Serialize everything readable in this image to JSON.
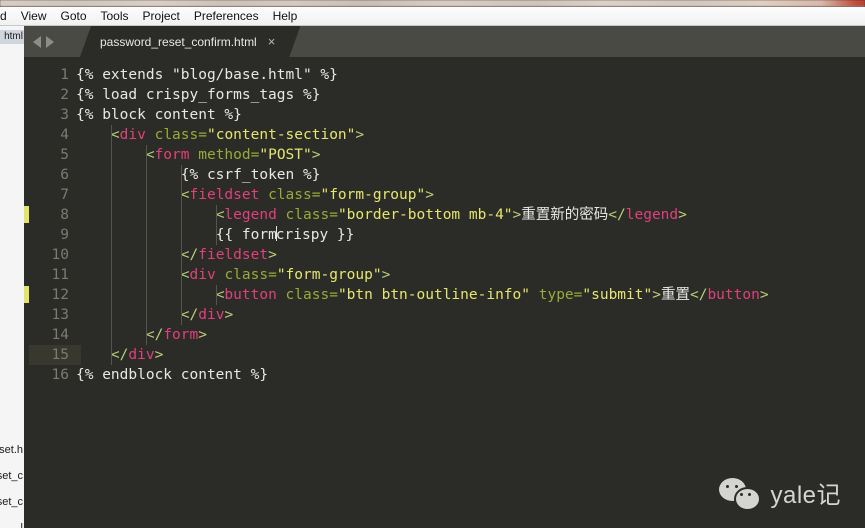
{
  "window": {
    "app": "Sublime Text",
    "menubar": {
      "items": [
        {
          "label": "d",
          "accel": ""
        },
        {
          "label": "View",
          "accel": "V"
        },
        {
          "label": "Goto",
          "accel": "G"
        },
        {
          "label": "Tools",
          "accel": "T"
        },
        {
          "label": "Project",
          "accel": "P"
        },
        {
          "label": "Preferences",
          "accel": "n"
        },
        {
          "label": "Help",
          "accel": "H"
        }
      ]
    }
  },
  "left_panel": {
    "tab_label": "html",
    "files": [
      "eset.h",
      "eset_c",
      "eset_c",
      "l"
    ]
  },
  "tabbar": {
    "nav_back_icon": "chevron-left-icon",
    "nav_forward_icon": "chevron-right-icon",
    "active_tab": {
      "name": "password_reset_confirm.html",
      "close_icon": "×"
    }
  },
  "editor": {
    "current_line": 15,
    "modified_lines": [
      8,
      12
    ],
    "line_numbers": [
      1,
      2,
      3,
      4,
      5,
      6,
      7,
      8,
      9,
      10,
      11,
      12,
      13,
      14,
      15,
      16
    ],
    "lines": [
      {
        "n": 1,
        "indent": 0,
        "text": "{% extends \"blog/base.html\" %}"
      },
      {
        "n": 2,
        "indent": 0,
        "text": "{% load crispy_forms_tags %}"
      },
      {
        "n": 3,
        "indent": 0,
        "text": "{% block content %}"
      },
      {
        "n": 4,
        "indent": 1,
        "text": "<div class=\"content-section\">"
      },
      {
        "n": 5,
        "indent": 2,
        "text": "<form method=\"POST\">"
      },
      {
        "n": 6,
        "indent": 3,
        "text": "{% csrf_token %}"
      },
      {
        "n": 7,
        "indent": 3,
        "text": "<fieldset class=\"form-group\">"
      },
      {
        "n": 8,
        "indent": 4,
        "text": "<legend class=\"border-bottom mb-4\">重置新的密码</legend>"
      },
      {
        "n": 9,
        "indent": 4,
        "text": "{{ form|crispy }}"
      },
      {
        "n": 10,
        "indent": 3,
        "text": "</fieldset>"
      },
      {
        "n": 11,
        "indent": 3,
        "text": "<div class=\"form-group\">"
      },
      {
        "n": 12,
        "indent": 4,
        "text": "<button class=\"btn btn-outline-info\" type=\"submit\">重置</button>"
      },
      {
        "n": 13,
        "indent": 3,
        "text": "</div>"
      },
      {
        "n": 14,
        "indent": 2,
        "text": "</form>"
      },
      {
        "n": 15,
        "indent": 1,
        "text": "</div>"
      },
      {
        "n": 16,
        "indent": 0,
        "text": "{% endblock content %}"
      }
    ],
    "legend_text": "重置新的密码",
    "button_text": "重置",
    "colors": {
      "background": "#2b2b28",
      "gutter_text": "#7b7b70",
      "current_line_highlight": "#38382f",
      "tag": "#e0407b",
      "attribute": "#9aaa36",
      "string": "#e6e66e",
      "punctuation": "#b9d07a",
      "plain": "#e8e8e3",
      "modified_marker": "#e4e46a",
      "tabbar": "#4a4a45"
    }
  },
  "watermark": {
    "icon": "wechat-logo-icon",
    "text": "yale记"
  }
}
